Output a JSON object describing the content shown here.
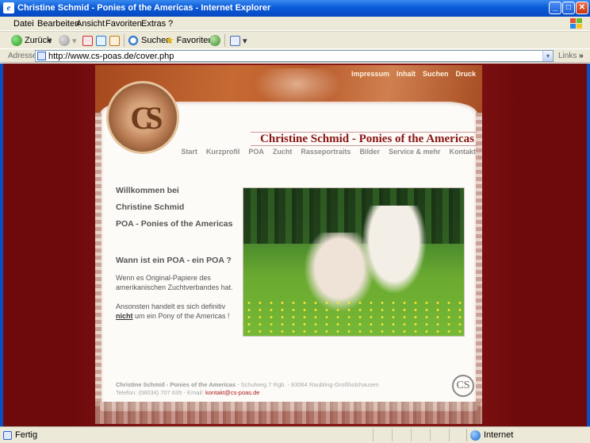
{
  "window": {
    "title": "Christine Schmid - Ponies of the Americas - Internet Explorer",
    "minimize": "_",
    "maximize": "□",
    "close": "✕"
  },
  "menubar": {
    "items": [
      "Datei",
      "Bearbeiten",
      "Ansicht",
      "Favoriten",
      "Extras",
      "?"
    ]
  },
  "toolbar": {
    "back_label": "Zurück",
    "search_label": "Suchen",
    "favorites_label": "Favoriten",
    "dropdown_glyph": "▾"
  },
  "addressbar": {
    "label": "Adresse",
    "url": "http://www.cs-poas.de/cover.php",
    "links_label": "Links",
    "more_glyph": "»"
  },
  "site": {
    "seal_letters": "CS",
    "top_nav": [
      "Impressum",
      "Inhalt",
      "Suchen",
      "Druck"
    ],
    "title": "Christine Schmid - Ponies of the Americas",
    "main_nav": [
      "Start",
      "Kurzprofil",
      "POA",
      "Zucht",
      "Rasseportraits",
      "Bilder",
      "Service & mehr",
      "Kontakt"
    ],
    "welcome_lines": [
      "Willkommen bei",
      "Christine Schmid",
      "POA - Ponies of the Americas"
    ],
    "question": "Wann ist ein POA - ein POA ?",
    "para1": "Wenn es Original-Papiere des amerikanischen Zuchtverbandes hat.",
    "para2_before": "Ansonsten handelt es sich definitiv",
    "para2_bold": "nicht",
    "para2_after": " um ein Pony of the Americas !",
    "footer": {
      "name": "Christine Schmid - Ponies of the Americas",
      "address": " - Schulweg 7 Rgb. - 83064 Raubling-Großholzhausen",
      "phone": "Telefon: (08034) 707 635 - Email: ",
      "email": "kontakt@cs-poas.de",
      "logo_letters": "CS"
    }
  },
  "statusbar": {
    "status": "Fertig",
    "zone": "Internet"
  },
  "colors": {
    "xp_blue": "#0a5ad8",
    "page_background": "#6e0a0c",
    "site_title": "#8a1414",
    "link_red": "#b01818"
  }
}
